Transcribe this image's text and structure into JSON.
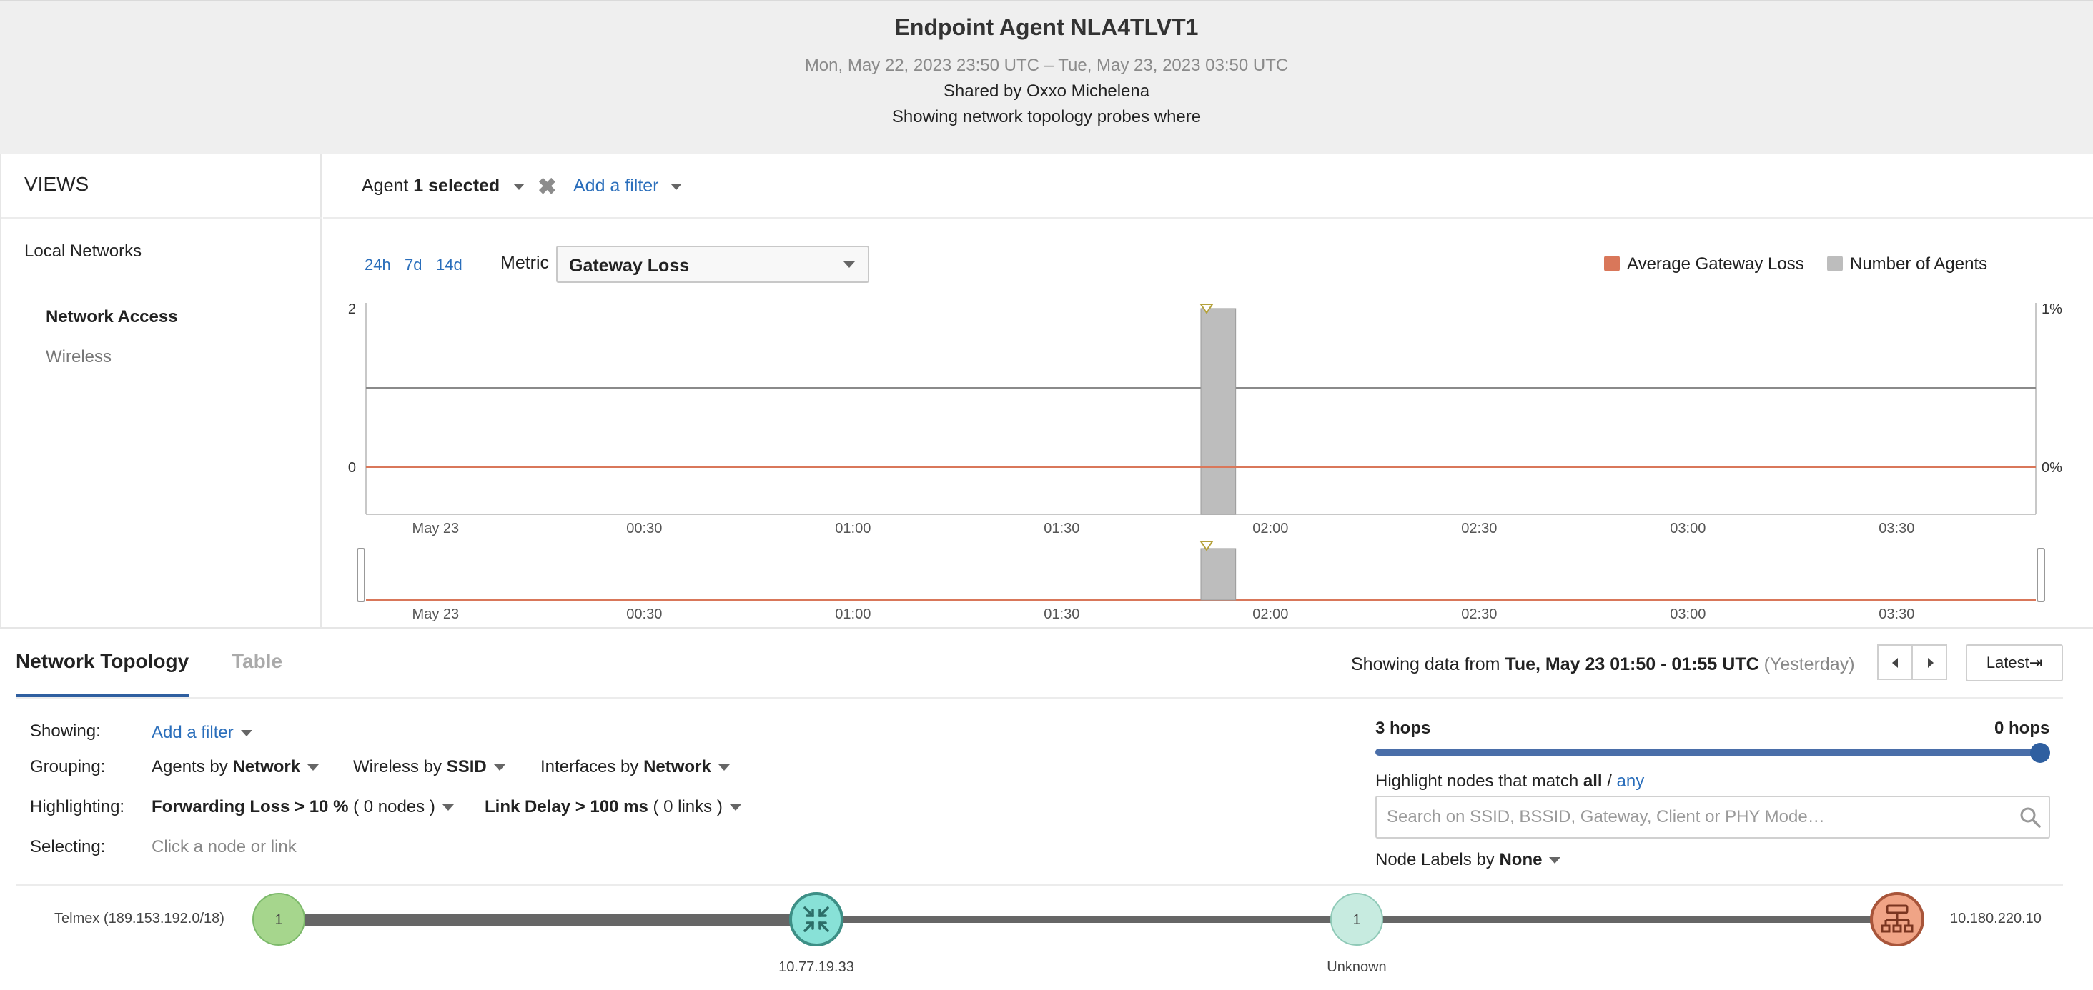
{
  "header": {
    "title": "Endpoint Agent NLA4TLVT1",
    "date_range": "Mon, May 22, 2023 23:50 UTC – Tue, May 23, 2023 03:50 UTC",
    "shared_by": "Shared by Oxxo Michelena",
    "showing": "Showing network topology probes where"
  },
  "sidebar": {
    "views_title": "VIEWS",
    "items": [
      {
        "label": "Local Networks"
      },
      {
        "label": "Network Access"
      },
      {
        "label": "Wireless"
      }
    ]
  },
  "filterbar": {
    "agent_prefix": "Agent",
    "agent_selected": "1 selected",
    "clear_symbol": "✖",
    "add_filter": "Add a filter"
  },
  "chart_controls": {
    "ranges": [
      "24h",
      "7d",
      "14d"
    ],
    "metric_label": "Metric",
    "metric_value": "Gateway Loss"
  },
  "chart_data": {
    "type": "bar",
    "x": [
      "May 23",
      "00:30",
      "01:00",
      "01:30",
      "02:00",
      "02:30",
      "03:00",
      "03:30"
    ],
    "x_range": [
      "May 22 23:50",
      "May 23 03:50"
    ],
    "yleft_ticks": [
      "0",
      "2"
    ],
    "yright_ticks": [
      "0%",
      "1%"
    ],
    "ylim_left": [
      0,
      2
    ],
    "ylim_right": [
      0,
      1
    ],
    "series": [
      {
        "name": "Average Gateway Loss",
        "type": "line",
        "color": "#d9775a",
        "points": [
          [
            "May 22 23:50",
            0
          ],
          [
            "May 23 03:50",
            0
          ]
        ]
      },
      {
        "name": "Number of Agents",
        "type": "bar",
        "color": "#bdbdbd",
        "points": [
          [
            "May 23 01:50",
            2
          ]
        ]
      }
    ],
    "reference_line_left": 1,
    "marker_time": "May 23 01:50"
  },
  "bottom": {
    "tabs": [
      {
        "label": "Network Topology"
      },
      {
        "label": "Table"
      }
    ],
    "showing_prefix": "Showing data from",
    "showing_range": "Tue, May 23 01:50 - 01:55 UTC",
    "showing_suffix": "(Yesterday)",
    "latest_label": "Latest⇥",
    "rows": {
      "showing_label": "Showing:",
      "showing_value": "Add a filter",
      "grouping_label": "Grouping:",
      "grouping": [
        {
          "prefix": "Agents by",
          "value": "Network"
        },
        {
          "prefix": "Wireless by",
          "value": "SSID"
        },
        {
          "prefix": "Interfaces by",
          "value": "Network"
        }
      ],
      "highlighting_label": "Highlighting:",
      "highlighting": [
        {
          "rule": "Forwarding Loss > 10 %",
          "count": "( 0 nodes )"
        },
        {
          "rule": "Link Delay > 100 ms",
          "count": "( 0 links )"
        }
      ],
      "selecting_label": "Selecting:",
      "selecting_value": "Click a node or link"
    },
    "hops_left": "3 hops",
    "hops_right": "0 hops",
    "hops_value": 0,
    "highlight_prefix": "Highlight nodes that match",
    "highlight_all": "all",
    "highlight_sep": " / ",
    "highlight_any": "any",
    "search_placeholder": "Search on SSID, BSSID, Gateway, Client or PHY Mode…",
    "node_labels_prefix": "Node Labels by",
    "node_labels_value": "None"
  },
  "topology": {
    "left_label": "Telmex (189.153.192.0/18)",
    "right_label": "10.180.220.10",
    "nodes": [
      {
        "count": "1",
        "label": ""
      },
      {
        "count": "",
        "label": "10.77.19.33"
      },
      {
        "count": "1",
        "label": "Unknown"
      },
      {
        "count": "",
        "label": ""
      }
    ]
  }
}
